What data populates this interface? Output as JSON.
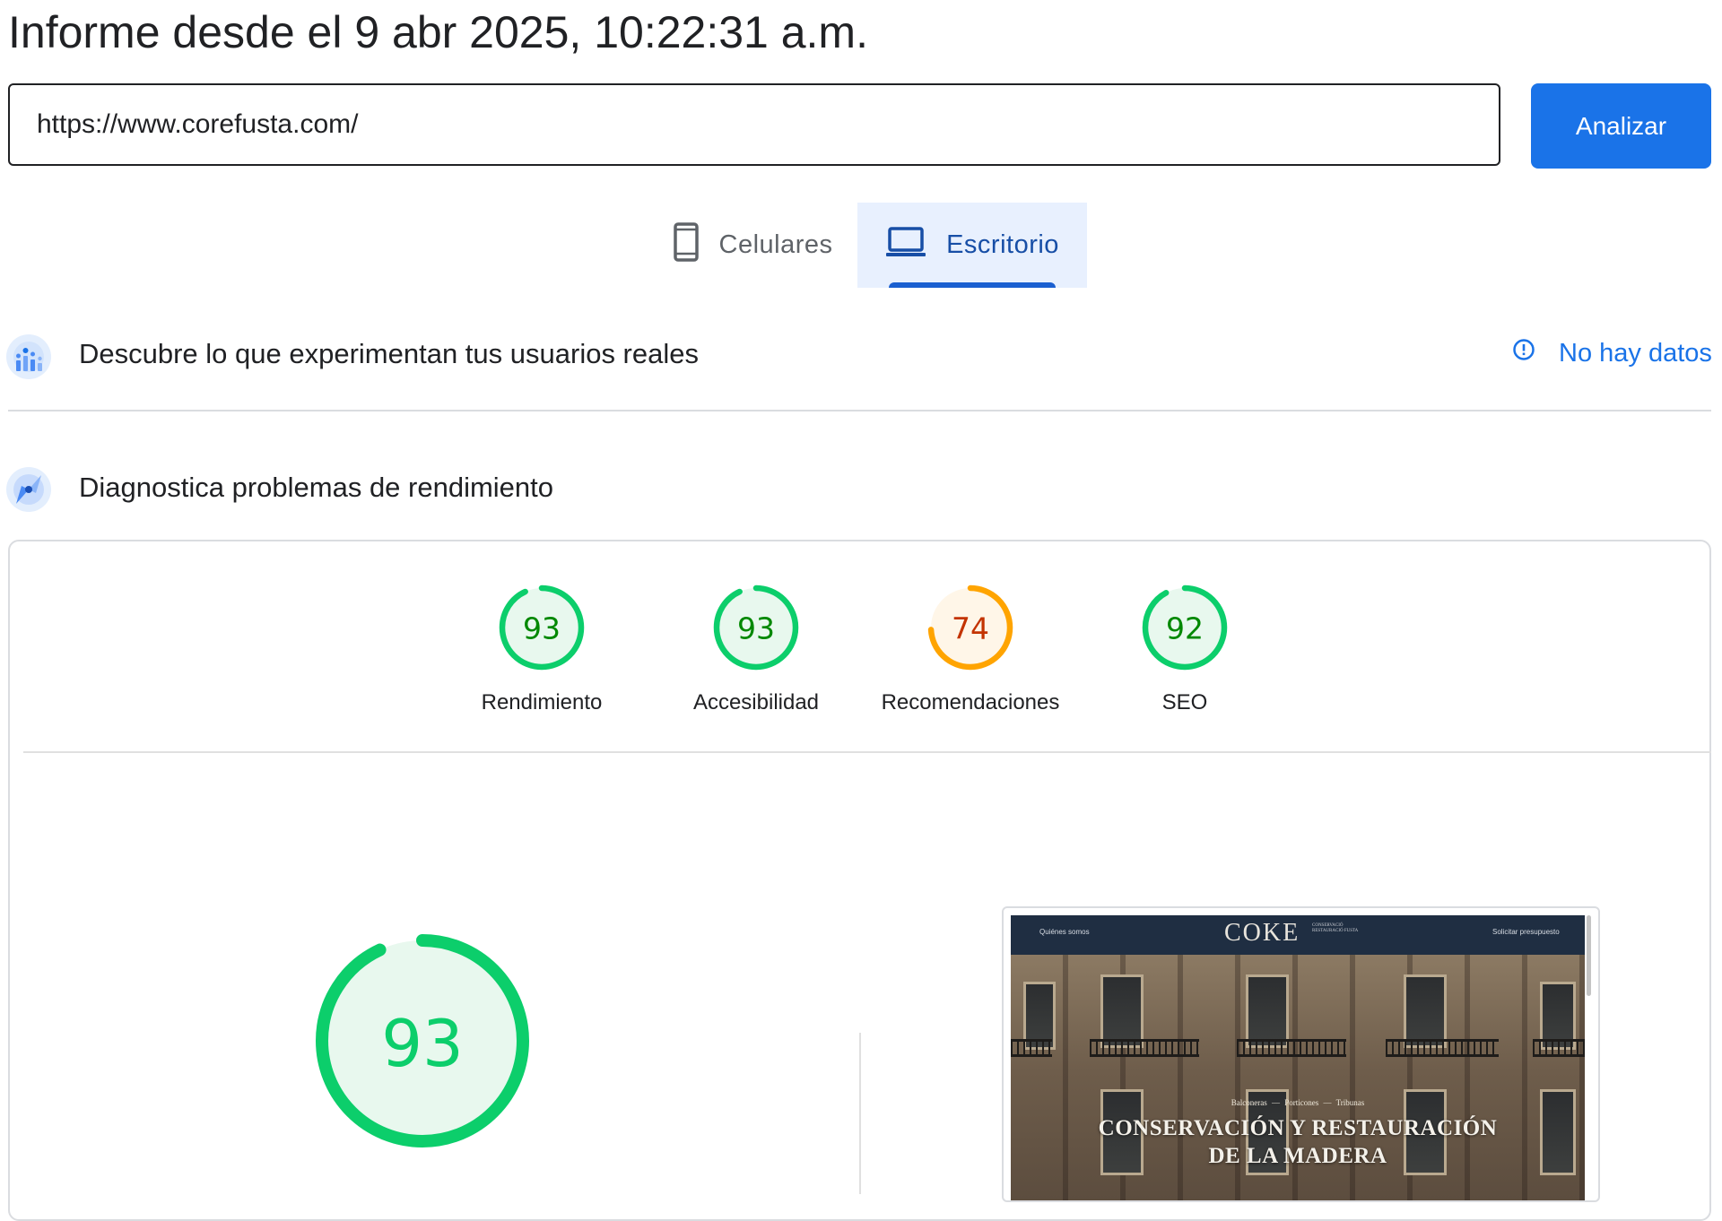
{
  "header": {
    "title": "Informe desde el 9 abr 2025, 10:22:31 a.m."
  },
  "search": {
    "url_value": "https://www.corefusta.com/",
    "analyze_label": "Analizar"
  },
  "tabs": [
    {
      "label": "Celulares",
      "icon": "smartphone-icon",
      "selected": false
    },
    {
      "label": "Escritorio",
      "icon": "laptop-icon",
      "selected": true
    }
  ],
  "field_data": {
    "title": "Descubre lo que experimentan tus usuarios reales",
    "status_label": "No hay datos",
    "icon": "users-chart-icon",
    "status_icon": "info-icon"
  },
  "lab_data": {
    "title": "Diagnostica problemas de rendimiento",
    "icon": "compass-icon"
  },
  "scores": [
    {
      "label": "Rendimiento",
      "value": 93,
      "rating": "good"
    },
    {
      "label": "Accesibilidad",
      "value": 93,
      "rating": "good"
    },
    {
      "label": "Recomendaciones",
      "value": 74,
      "rating": "average"
    },
    {
      "label": "SEO",
      "value": 92,
      "rating": "good"
    }
  ],
  "main_score": {
    "value": 93,
    "rating": "good"
  },
  "colors": {
    "good": "#0cce6b",
    "good_text": "#008800",
    "good_bg": "#e8f8ee",
    "average": "#ffa400",
    "average_text": "#c33300",
    "average_bg": "#fff6e8",
    "accent": "#1a73e8"
  },
  "screenshot": {
    "nav_left": "Quiénes somos",
    "nav_right": "Solicitar presupuesto",
    "logo": "COKE",
    "logo_sub": "CONSERVACIÓ RESTAURACIÓ FUSTA",
    "categories": "Balconeras  —  Porticones  —  Tribunas",
    "headline_line1": "CONSERVACIÓN Y RESTAURACIÓN",
    "headline_line2": "DE LA MADERA"
  }
}
